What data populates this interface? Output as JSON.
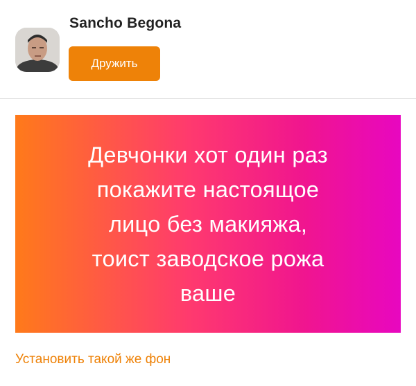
{
  "post": {
    "author_name": "Sancho Begona",
    "friend_button_label": "Дружить",
    "text": "Девчонки хот один раз\nпокажите настоящое\nлицо без макияжа,\nтоист заводское рожа\nваше",
    "set_background_link": "Установить такой же фон"
  },
  "colors": {
    "accent": "#ee8208",
    "gradient_start": "#ff7a1a",
    "gradient_middle": "#ff3a6e",
    "gradient_end": "#e807c0",
    "divider": "#e3e3e3"
  }
}
